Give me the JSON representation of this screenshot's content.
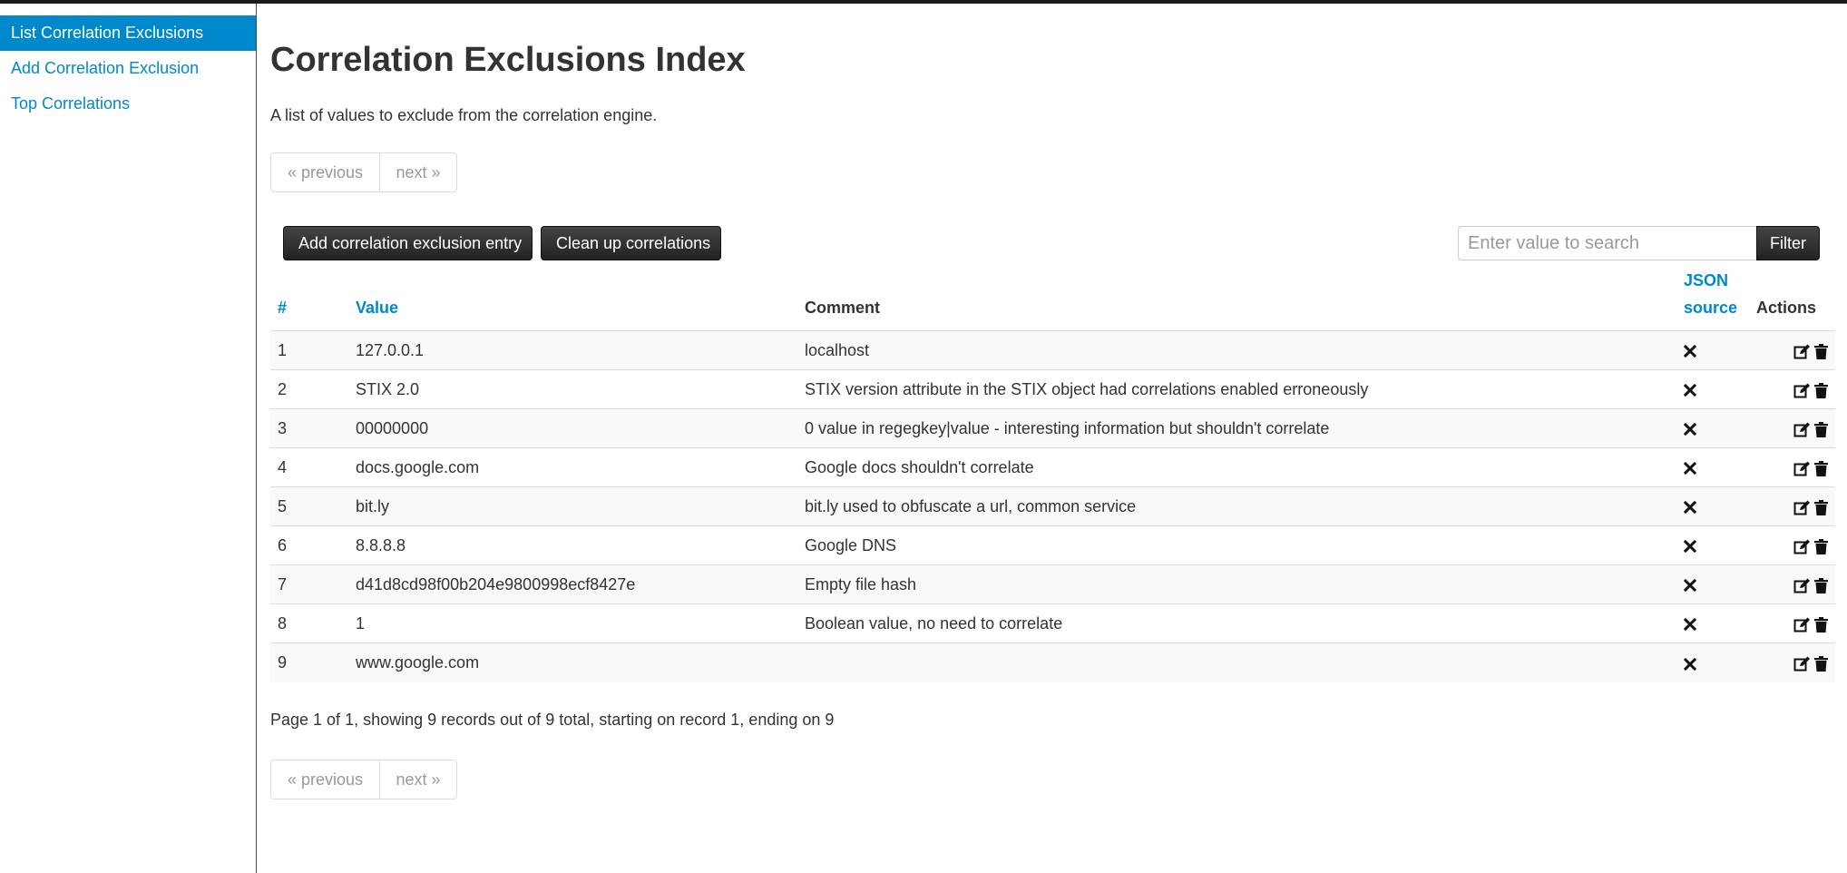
{
  "sidebar": {
    "items": [
      {
        "label": "List Correlation Exclusions",
        "active": true
      },
      {
        "label": "Add Correlation Exclusion",
        "active": false
      },
      {
        "label": "Top Correlations",
        "active": false
      }
    ]
  },
  "header": {
    "title": "Correlation Exclusions Index",
    "description": "A list of values to exclude from the correlation engine."
  },
  "pagination": {
    "previous": "« previous",
    "next": "next »",
    "summary": "Page 1 of 1, showing 9 records out of 9 total, starting on record 1, ending on 9"
  },
  "toolbar": {
    "add_label": "Add correlation exclusion entry",
    "cleanup_label": "Clean up correlations",
    "search_placeholder": "Enter value to search",
    "filter_label": "Filter"
  },
  "table": {
    "headers": {
      "num": "#",
      "value": "Value",
      "comment": "Comment",
      "json_line1": "JSON",
      "json_line2": "source",
      "actions": "Actions"
    },
    "rows": [
      {
        "id": "1",
        "value": "127.0.0.1",
        "comment": "localhost"
      },
      {
        "id": "2",
        "value": "STIX 2.0",
        "comment": "STIX version attribute in the STIX object had correlations enabled erroneously"
      },
      {
        "id": "3",
        "value": "00000000",
        "comment": "0 value in regegkey|value - interesting information but shouldn't correlate"
      },
      {
        "id": "4",
        "value": "docs.google.com",
        "comment": "Google docs shouldn't correlate"
      },
      {
        "id": "5",
        "value": "bit.ly",
        "comment": "bit.ly used to obfuscate a url, common service"
      },
      {
        "id": "6",
        "value": "8.8.8.8",
        "comment": "Google DNS"
      },
      {
        "id": "7",
        "value": "d41d8cd98f00b204e9800998ecf8427e",
        "comment": "Empty file hash"
      },
      {
        "id": "8",
        "value": "1",
        "comment": "Boolean value, no need to correlate"
      },
      {
        "id": "9",
        "value": "www.google.com",
        "comment": ""
      }
    ]
  },
  "icons": {
    "json_source": "times-icon",
    "edit": "edit-icon",
    "delete": "trash-icon"
  },
  "colors": {
    "link": "#0088cc",
    "active_bg": "#0088cc",
    "button_dark": "#222222"
  }
}
